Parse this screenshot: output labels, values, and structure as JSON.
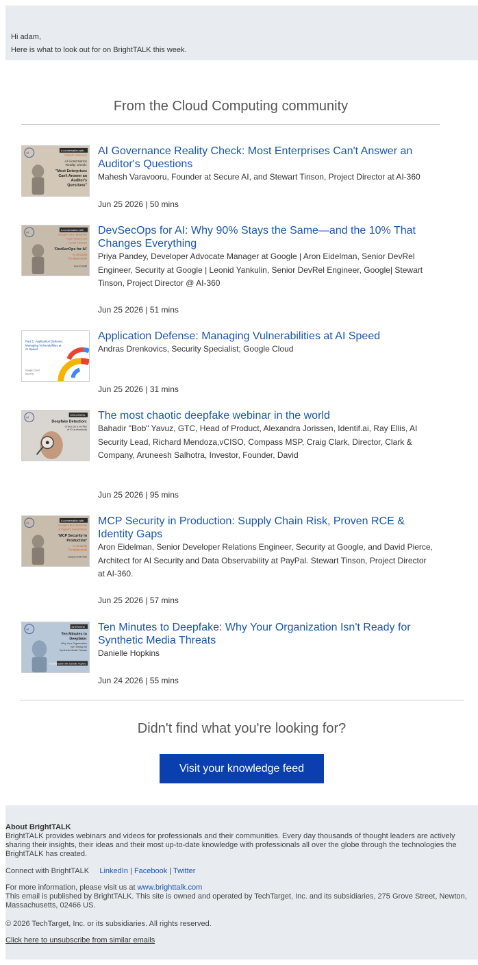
{
  "header": {
    "greeting": "Hi adam,",
    "intro": "Here is what to look out for on BrightTALK this week."
  },
  "section": {
    "title": "From the Cloud Computing community"
  },
  "webinars": [
    {
      "title": "AI Governance Reality Check: Most Enterprises Can't Answer an Auditor's Questions",
      "speakers": "Mahesh Varavooru, Founder at Secure AI, and Stewart Tinson, Project Director at AI-360",
      "meta": "Jun 25 2026 | 50 mins",
      "thumb": {
        "badge": "A conversation with",
        "names": "Mahesh Varavooru",
        "line1": "AI Governance",
        "line2": "Reality Check:",
        "line3": "\"Most Enterprises",
        "line4": "Can't Answer an",
        "line5": "Auditor's",
        "line6": "Questions\""
      }
    },
    {
      "title": "DevSecOps for AI: Why 90% Stays the Same—and the 10% That Changes Everything",
      "speakers": "Priya Pandey, Developer Advocate Manager at Google | Aron Eidelman, Senior DevRel Engineer, Security at Google | Leonid Yankulin, Senior DevRel Engineer, Google| Stewart Tinson, Project Director @ AI-360",
      "meta": "Jun 25 2026 | 51 mins",
      "thumb": {
        "badge": "A conversation with",
        "names": "Google's Aron Eidelman",
        "line1": "Priya Pandey and",
        "line2": "Leonid Yankulin",
        "line3": "'DevSecOps for AI'",
        "line4": "AI Security",
        "line5": "Fundamentals",
        "line6": "How to Build"
      }
    },
    {
      "title": "Application Defense: Managing Vulnerabilities at AI Speed",
      "speakers": "Andras Drenkovics, Security Specialist; Google Cloud",
      "meta": "Jun 25 2026 | 31 mins",
      "thumb": {
        "badge": "Part 3:",
        "line1": "Application Defense:",
        "line2": "Managing Vulnerabilities at",
        "line3": "AI Speed",
        "line4": "Google Cloud",
        "line5": "Security"
      }
    },
    {
      "title": "The most chaotic deepfake webinar in the world",
      "speakers": "Bahadir \"Bob\" Yavuz, GTC, Head of Product, Alexandra Jorissen, Identif.ai, Ray Ellis, AI Security Lead, Richard Mendoza,vCISO, Compass MSP, Craig Clark, Director, Clark & Company, Aruneesh Salhotra, Investor, Founder, David",
      "meta": "Jun 25 2026 | 95 mins",
      "thumb": {
        "badge": "DISCUSSION",
        "line1": "Deepfake Detection:",
        "line2": "Chaos as a verifier",
        "line3": "of ID authenticity"
      }
    },
    {
      "title": "MCP Security in Production: Supply Chain Risk, Proven RCE & Identity Gaps",
      "speakers": "Aron Eidelman, Senior Developer Relations Engineer, Security at Google, and David Pierce, Architect for AI Security and Data Observability at PayPal. Stewart Tinson, Project Director at AI-360.",
      "meta": "Jun 25 2026 | 57 mins",
      "thumb": {
        "badge": "A conversation with",
        "names": "Google's Aron Eidelman",
        "line1": "& Paypal's David Pierce",
        "line2": "'MCP Security in",
        "line3": "Production'",
        "line4": "AI Security",
        "line5": "Fundamentals",
        "line6": "Supply Chain Risk"
      }
    },
    {
      "title": "Ten Minutes to Deepfake: Why Your Organization Isn't Ready for Synthetic Media Threats",
      "speakers": "Danielle Hopkins",
      "meta": "Jun 24 2026 | 55 mins",
      "thumb": {
        "badge": "INTERVIEW",
        "line1": "Ten Minutes to",
        "line2": "Deepfake:",
        "line3": "Why Your Organization",
        "line4": "Isn't Ready for",
        "line5": "Synthetic Media Threats",
        "names": "A conversation with Danielle Hopkins"
      }
    }
  ],
  "cta": {
    "heading": "Didn't find what you're looking for?",
    "button_label": "Visit your knowledge feed"
  },
  "footer": {
    "about_heading": "About BrightTALK",
    "about_text": "BrightTALK provides webinars and videos for professionals and their communities. Every day thousands of thought leaders are actively sharing their insights, their ideas and their most up-to-date knowledge with professionals all over the globe through the technologies the BrightTALK has created.",
    "connect_label": "Connect with BrightTALK",
    "social": [
      "LinkedIn",
      "Facebook",
      "Twitter"
    ],
    "more_info_prefix": "For more information, please visit us at ",
    "site_link": "www.brighttalk.com",
    "publisher_text": "This email is published by BrightTALK. This site is owned and operated by TechTarget, Inc. and its subsidiaries, 275 Grove Street, Newton, Massachusetts, 02466 US.",
    "copyright": "© 2026 TechTarget, Inc. or its subsidiaries. All rights reserved.",
    "unsubscribe": "Click here to unsubscribe from similar emails"
  },
  "colors": {
    "link": "#1a56a8",
    "button": "#0b3fb0",
    "band": "#e8ecf0"
  }
}
